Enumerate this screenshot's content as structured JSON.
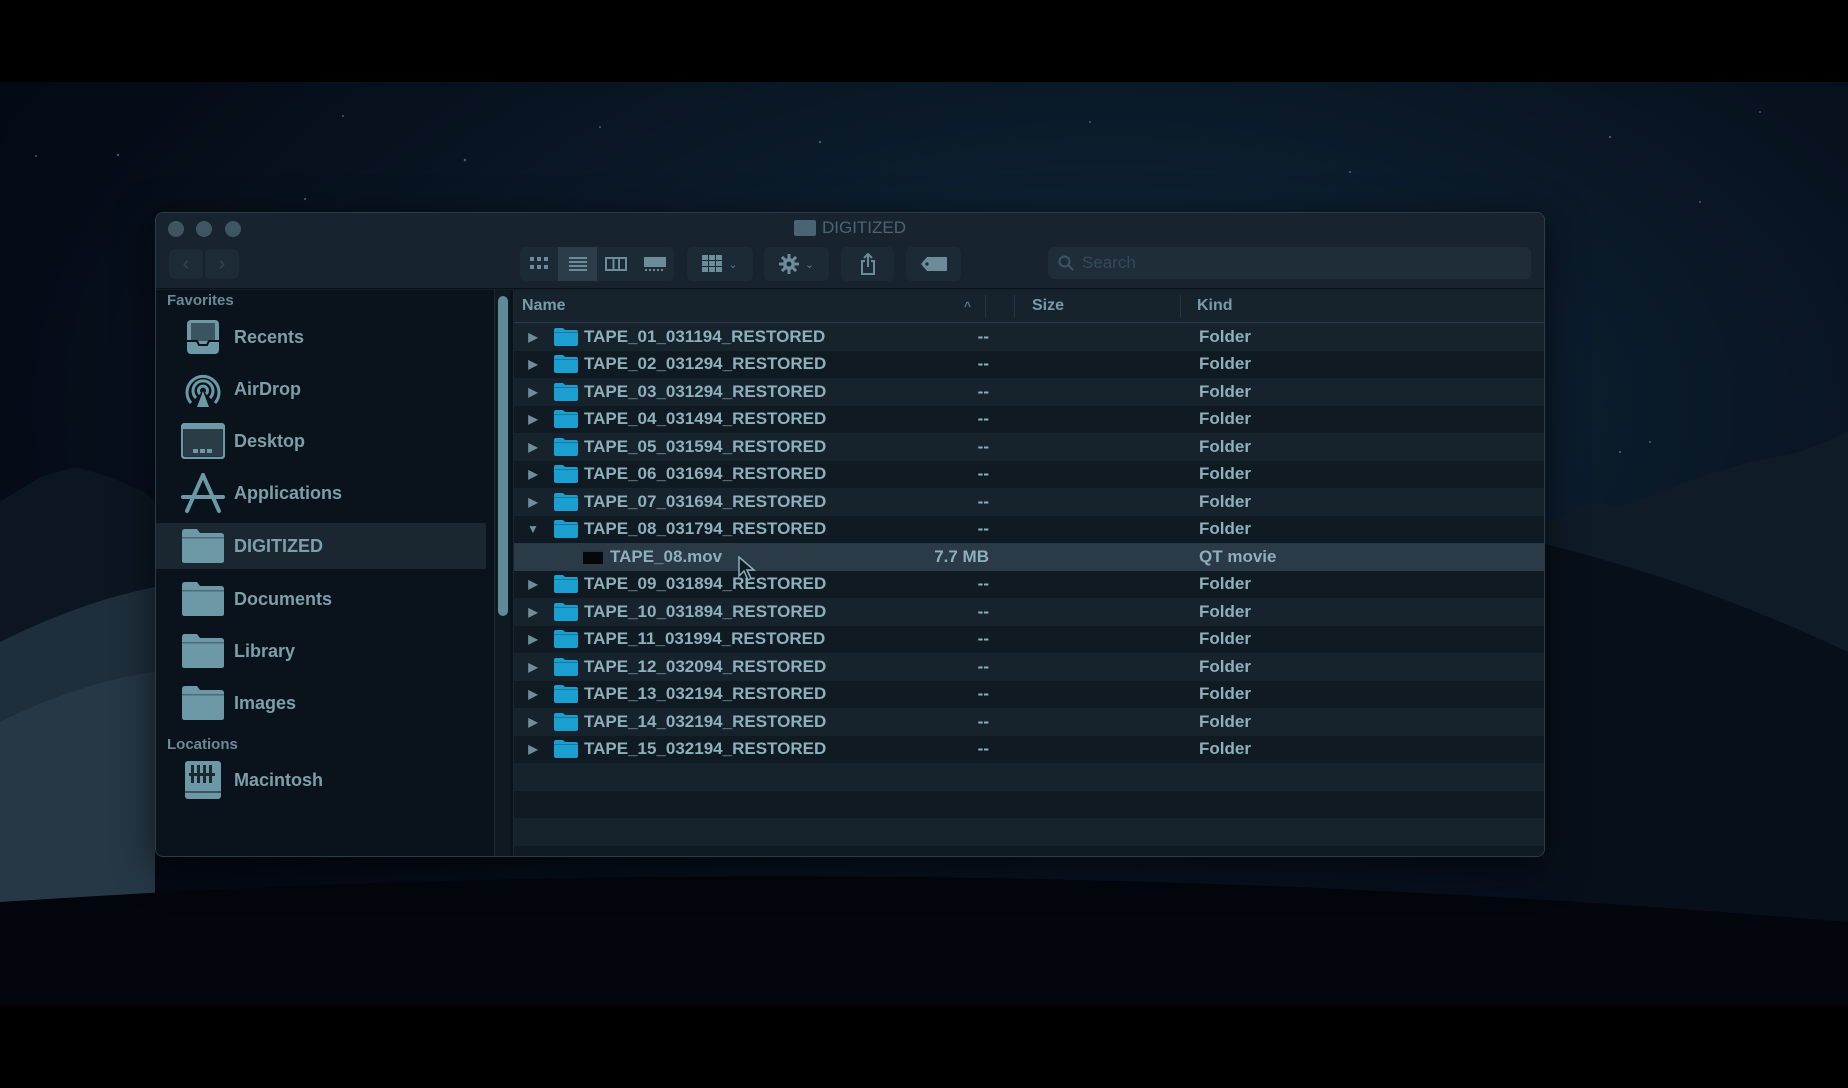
{
  "window": {
    "title": "DIGITIZED",
    "traffic_lights": [
      "close",
      "minimize",
      "zoom"
    ]
  },
  "toolbar": {
    "back_label": "‹",
    "forward_label": "›",
    "view_modes": [
      "icon-view",
      "list-view",
      "column-view",
      "gallery-view"
    ],
    "active_view": "list-view",
    "group_by_label": "group",
    "action_label": "action",
    "share_label": "share",
    "tag_label": "tags",
    "search_placeholder": "Search",
    "chevron": "⌄"
  },
  "sidebar": {
    "favorites_heading": "Favorites",
    "favorites": [
      {
        "label": "Recents",
        "icon": "recents-icon"
      },
      {
        "label": "AirDrop",
        "icon": "airdrop-icon"
      },
      {
        "label": "Desktop",
        "icon": "desktop-icon"
      },
      {
        "label": "Applications",
        "icon": "applications-icon"
      },
      {
        "label": "DIGITIZED",
        "icon": "folder-icon",
        "selected": true
      },
      {
        "label": "Documents",
        "icon": "folder-icon"
      },
      {
        "label": "Library",
        "icon": "folder-icon"
      },
      {
        "label": "Images",
        "icon": "folder-icon"
      }
    ],
    "locations_heading": "Locations",
    "locations": [
      {
        "label": "Macintosh",
        "icon": "hard-drive-icon"
      }
    ]
  },
  "list": {
    "columns": {
      "name": "Name",
      "size": "Size",
      "kind": "Kind"
    },
    "sort_indicator": "^",
    "rows": [
      {
        "name": "TAPE_01_031194_RESTORED",
        "size": "--",
        "kind": "Folder",
        "type": "folder",
        "expanded": false
      },
      {
        "name": "TAPE_02_031294_RESTORED",
        "size": "--",
        "kind": "Folder",
        "type": "folder",
        "expanded": false
      },
      {
        "name": "TAPE_03_031294_RESTORED",
        "size": "--",
        "kind": "Folder",
        "type": "folder",
        "expanded": false
      },
      {
        "name": "TAPE_04_031494_RESTORED",
        "size": "--",
        "kind": "Folder",
        "type": "folder",
        "expanded": false
      },
      {
        "name": "TAPE_05_031594_RESTORED",
        "size": "--",
        "kind": "Folder",
        "type": "folder",
        "expanded": false
      },
      {
        "name": "TAPE_06_031694_RESTORED",
        "size": "--",
        "kind": "Folder",
        "type": "folder",
        "expanded": false
      },
      {
        "name": "TAPE_07_031694_RESTORED",
        "size": "--",
        "kind": "Folder",
        "type": "folder",
        "expanded": false
      },
      {
        "name": "TAPE_08_031794_RESTORED",
        "size": "--",
        "kind": "Folder",
        "type": "folder",
        "expanded": true
      },
      {
        "name": "TAPE_08.mov",
        "size": "7.7 MB",
        "kind": "QT movie",
        "type": "movie",
        "child": true,
        "selected": true
      },
      {
        "name": "TAPE_09_031894_RESTORED",
        "size": "--",
        "kind": "Folder",
        "type": "folder",
        "expanded": false
      },
      {
        "name": "TAPE_10_031894_RESTORED",
        "size": "--",
        "kind": "Folder",
        "type": "folder",
        "expanded": false
      },
      {
        "name": "TAPE_11_031994_RESTORED",
        "size": "--",
        "kind": "Folder",
        "type": "folder",
        "expanded": false
      },
      {
        "name": "TAPE_12_032094_RESTORED",
        "size": "--",
        "kind": "Folder",
        "type": "folder",
        "expanded": false
      },
      {
        "name": "TAPE_13_032194_RESTORED",
        "size": "--",
        "kind": "Folder",
        "type": "folder",
        "expanded": false
      },
      {
        "name": "TAPE_14_032194_RESTORED",
        "size": "--",
        "kind": "Folder",
        "type": "folder",
        "expanded": false
      },
      {
        "name": "TAPE_15_032194_RESTORED",
        "size": "--",
        "kind": "Folder",
        "type": "folder",
        "expanded": false
      }
    ]
  },
  "colors": {
    "folder_accent": "#1b9fd0",
    "text": "#8db0bb",
    "sidebar_icon": "#6d98a6"
  }
}
